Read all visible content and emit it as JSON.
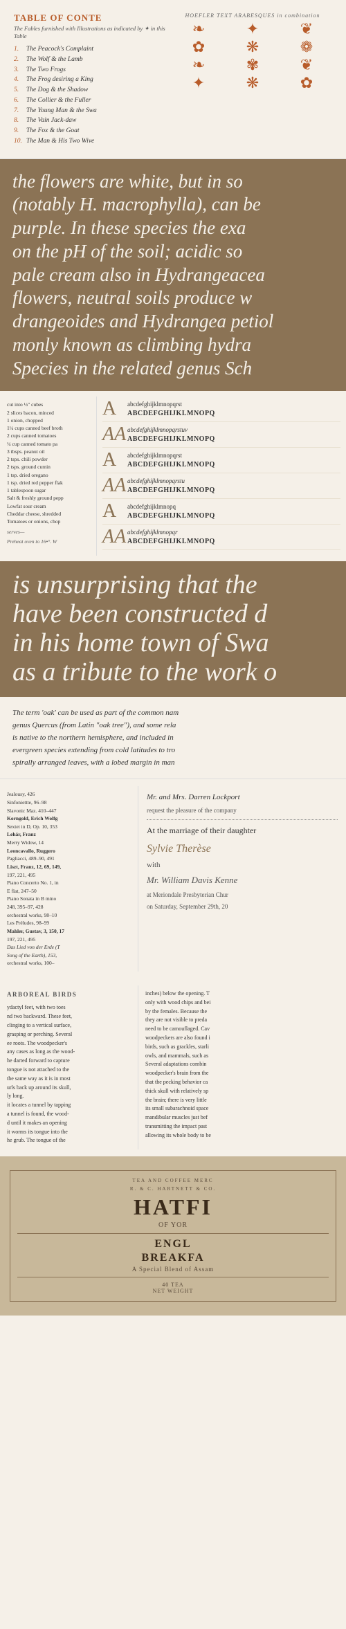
{
  "toc": {
    "title": "TABLE OF CONTE",
    "subtitle": "The Fables furnished with Illustrations as indicated by ✦ in this Table",
    "items": [
      {
        "num": "1.",
        "title": "The Peacock's Complaint"
      },
      {
        "num": "2.",
        "title": "The Wolf & the Lamb"
      },
      {
        "num": "3.",
        "title": "The Two Frogs"
      },
      {
        "num": "4.",
        "title": "The Frog desiring a King"
      },
      {
        "num": "5.",
        "title": "The Dog & the Shadow"
      },
      {
        "num": "6.",
        "title": "The Collier & the Fuller"
      },
      {
        "num": "7.",
        "title": "The Young Man & the Swa"
      },
      {
        "num": "8.",
        "title": "The Vain Jack-daw"
      },
      {
        "num": "9.",
        "title": "The Fox & the Goat"
      },
      {
        "num": "10.",
        "title": "The Man & His Two Wive"
      }
    ],
    "arabesque_label": "HOEFLER TEXT ARABESQUES in combination"
  },
  "hydrangea": {
    "lines": [
      "the flowers are white, but in so",
      "(notably H. macrophylla), can be",
      "purple. In these species the exa",
      "on the pH of the soil; acidic so",
      "pale cream also in Hydrangeacea",
      "flowers, neutral soils produce w",
      "drangeoides and Hydrangea petiol",
      "monly known as climbing hydra",
      "Species in the related genus Sch"
    ]
  },
  "typo_specimens": [
    {
      "letter": "A",
      "lower": "abcdefghijklmnopqrst",
      "upper": "ABCDEFGHIJKLMNOPQ"
    },
    {
      "letter": "AA",
      "lower": "abcdefghijklmnopqrstuv",
      "upper": "ABCDEFGHIJKLMNOPQ"
    },
    {
      "letter": "A",
      "lower": "abcdefghijklmnopqrst",
      "upper": "ABCDEFGHIJKLMNOPQ"
    },
    {
      "letter": "AA",
      "lower": "abcdefghijklmnopqrstu",
      "upper": "ABCDEFGHIJKLMNOPQ"
    },
    {
      "letter": "A",
      "lower": "abcdefghijklmnopq",
      "upper": "ABCDEFGHIJKLMNOPQ"
    },
    {
      "letter": "AA",
      "lower": "abcdefghijklmnopqr",
      "upper": "ABCDEFGHIJKLMNOPQ"
    }
  ],
  "typo_recipe": [
    "cut into ½\" cubes",
    "2 slices bacon, minced",
    "1 onion, chopped",
    "1¼ cups canned beef broth",
    "2 cups canned tomatoes",
    "¼ cup canned tomato pa",
    "",
    "3 tbsps. peanut oil",
    "2 tsps. chili powder",
    "2 tsps. ground cumin",
    "1 tsp. dried oregano",
    "1 tsp. dried red pepper flak",
    "1 tablespoon sugar",
    "Salt & freshly ground pepp",
    "",
    "Lowfat sour cream",
    "Cheddar cheese, shredded",
    "Tomatoes or onions, chop"
  ],
  "large_text": {
    "lines": [
      "is unsurprising that the",
      "have been constructed d",
      "in his home town of Swa",
      "as a tribute to the work o"
    ]
  },
  "oak_text": {
    "lines": [
      "The term 'oak' can be used as part of the common nam",
      "genus Quercus (from Latin \"oak tree\"), and some rela",
      "is native to the northern hemisphere, and included in",
      "evergreen species extending from cold latitudes to tro",
      "spirally arranged leaves, with a lobed margin in man"
    ]
  },
  "index": {
    "composers": [
      {
        "name": "Jealousy, 426",
        "style": "normal"
      },
      {
        "name": "Sinfoniettte, 96–98",
        "style": "normal"
      },
      {
        "name": "Slavonic Maz. 410–447",
        "style": "normal"
      },
      {
        "name": "Korngold, Erich Wolfg",
        "style": "bold"
      },
      {
        "name": "Sextet in D, Op. 10, 353",
        "style": "normal"
      },
      {
        "name": "Lehár, Franz",
        "style": "bold"
      },
      {
        "name": "Merry Widow, 14",
        "style": "normal"
      },
      {
        "name": "Leoncavallo, Ruggero",
        "style": "bold"
      },
      {
        "name": "Pagliacci, 489–90, 491",
        "style": "normal"
      },
      {
        "name": "Liszt, Franz, 12, 69, 149,",
        "style": "bold"
      },
      {
        "name": "197, 221, 495",
        "style": "normal"
      },
      {
        "name": "Piano Concerto No. 1, in",
        "style": "normal"
      },
      {
        "name": "E flat, 247–50",
        "style": "normal"
      },
      {
        "name": "Piano Sonata in B mino",
        "style": "normal"
      },
      {
        "name": "248, 395–97, 428",
        "style": "normal"
      },
      {
        "name": "orchestral works, 98–10",
        "style": "normal"
      },
      {
        "name": "Les Préludes, 98–99",
        "style": "normal"
      },
      {
        "name": "Mahler, Gustav, 3, 150, 17",
        "style": "bold"
      },
      {
        "name": "197, 221, 495",
        "style": "normal"
      },
      {
        "name": "Das Lied von der Erde (T",
        "style": "italic"
      },
      {
        "name": "Song of the Earth), 153,",
        "style": "italic"
      },
      {
        "name": "orchestral works, 100–",
        "style": "normal"
      }
    ],
    "invitation": {
      "from": "Mr. and Mrs. Darren Lockport",
      "request": "request the pleasure of the company",
      "at_marriage": "At the marriage of their daughter",
      "name": "Sylvie Therèse",
      "with": "with",
      "mr": "Mr. William Davis Kenne",
      "church": "at Meriondale Presbyterian Chur",
      "date": "on Saturday, September 29th, 20"
    }
  },
  "birds": {
    "left_title": "ARBOREAL BIRDS",
    "left_text": [
      "ydactyl feet, with two toes",
      "nd two backward. These feet,",
      "clinging to a vertical surface,",
      "grasping or perching. Several",
      "ee roots. The woodpecker's",
      "any cases as long as the wood-",
      "he darted forward to capture",
      "tongue is not attached to the",
      "the same way as it is in most",
      "urls back up around its skull,",
      "ly long.",
      "it locates a tunnel by tapping",
      "a tunnel is found, the wood-",
      "d until it makes an opening",
      "it worms its tongue into the",
      "he grub. The tongue of the"
    ],
    "right_text": [
      "inches) below the opening. T",
      "only with wood chips and bei",
      "by the females. Because the ",
      "they are not visible to preda",
      "need to be camouflaged. Cav",
      "woodpeckers are also found i",
      "birds, such as grackles, starli",
      "owls, and mammals, such as ",
      "",
      "Several adaptations combin",
      "woodpecker's brain from the",
      "that the pecking behavior ca",
      "thick skull with relatively sp",
      "the brain; there is very little",
      "its small subarachnoid space",
      "mandibular muscles just bef",
      "transmitting the impact past",
      "allowing its whole body to be"
    ]
  },
  "product": {
    "top_text": "TEA AND COFFEE MERC",
    "top_sub": "R. & C. HARTNETT & CO.",
    "brand": "HATFI",
    "brand_sub": "OF YOR",
    "section": "ENGL",
    "item": "BREAKFA",
    "item_sub": "A Special Blend of Assam",
    "weight_label": "40 TEA",
    "net_weight": "NET WEIGHT"
  }
}
